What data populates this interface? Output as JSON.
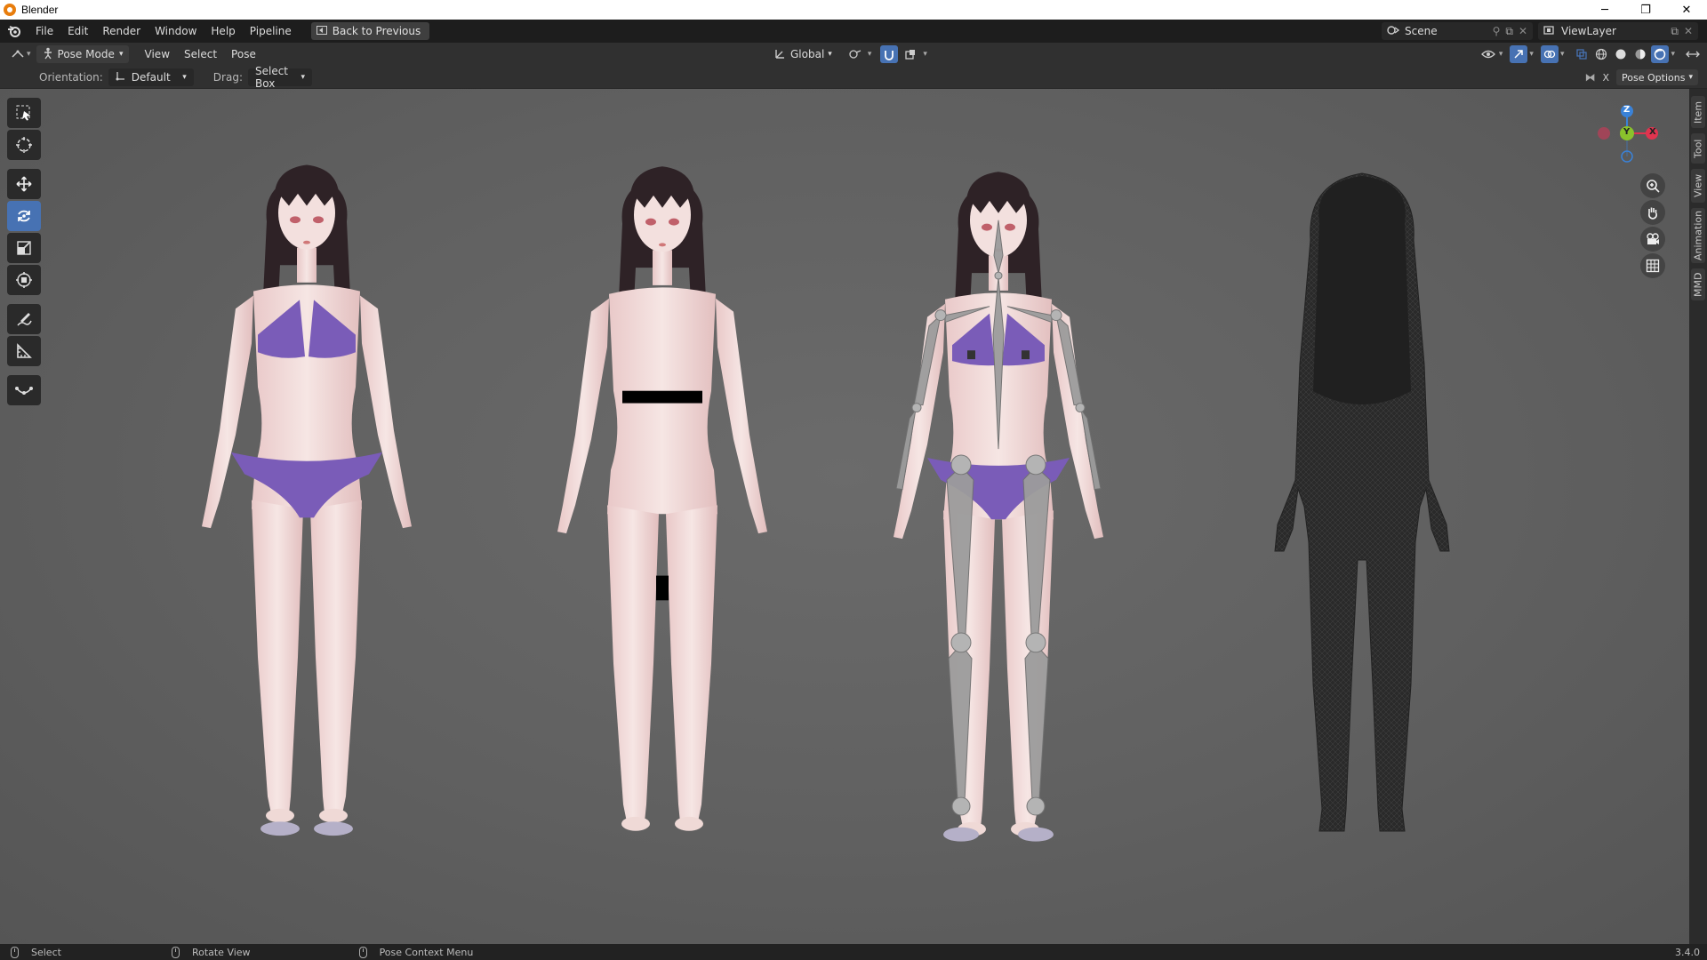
{
  "window": {
    "title": "Blender",
    "minimize": "─",
    "maximize": "❐",
    "close": "✕"
  },
  "menu": [
    "File",
    "Edit",
    "Render",
    "Window",
    "Help",
    "Pipeline"
  ],
  "back_button": "Back to Previous",
  "scene": {
    "name": "Scene",
    "view_layer": "ViewLayer"
  },
  "header": {
    "mode": "Pose Mode",
    "menus": [
      "View",
      "Select",
      "Pose"
    ],
    "transform_orientation": "Global"
  },
  "tool_settings": {
    "orientation_label": "Orientation:",
    "orientation_value": "Default",
    "drag_label": "Drag:",
    "drag_value": "Select Box"
  },
  "pose_options": "Pose Options",
  "side_tabs": [
    "Item",
    "Tool",
    "View",
    "Animation",
    "MMD"
  ],
  "gizmo": {
    "z": "Z",
    "y": "Y",
    "x": "X"
  },
  "status": {
    "left": "Select",
    "middle": "Rotate View",
    "right": "Pose Context Menu",
    "version": "3.4.0"
  },
  "colors": {
    "accent": "#4772b3",
    "x_axis": "#e0344f",
    "y_axis": "#8ac22c",
    "z_axis": "#3a82d8",
    "bikini": "#7a5cb8"
  }
}
